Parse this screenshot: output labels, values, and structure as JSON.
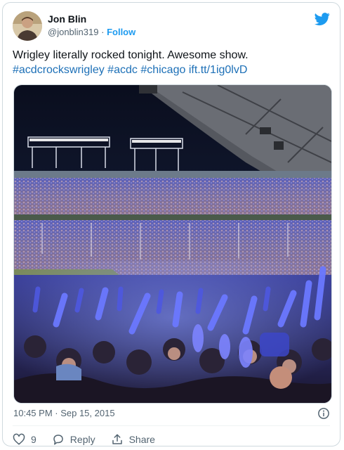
{
  "author": {
    "name": "Jon Blin",
    "handle": "@jonblin319",
    "separator": "·",
    "follow_label": "Follow"
  },
  "tweet": {
    "text": "Wrigley literally rocked tonight. Awesome show.",
    "hashtags": [
      "#acdcrockswrigley",
      "#acdc",
      "#chicago"
    ],
    "link": "ift.tt/1ig0lvD"
  },
  "meta": {
    "timestamp": "10:45 PM · Sep 15, 2015"
  },
  "actions": {
    "like_count": "9",
    "reply_label": "Reply",
    "share_label": "Share"
  },
  "icons": {
    "brand": "twitter-bird-icon",
    "info": "info-icon",
    "like": "heart-icon",
    "reply": "speech-bubble-icon",
    "share": "share-icon"
  },
  "colors": {
    "brand_blue": "#1d9bf0",
    "link_blue": "#1d70b7",
    "text_primary": "#0f1419",
    "text_secondary": "#536471"
  }
}
